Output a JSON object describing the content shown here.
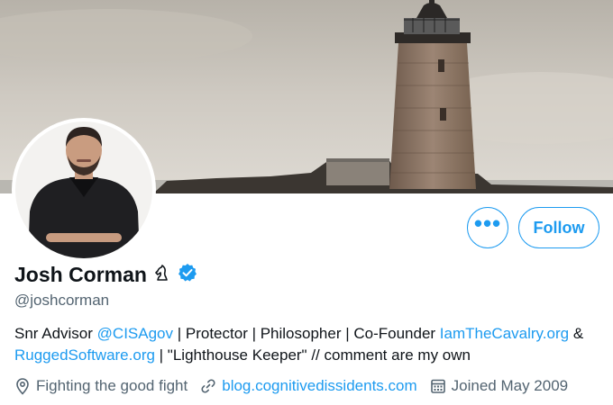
{
  "profile": {
    "name": "Josh Corman",
    "handle": "@joshcorman",
    "bio": {
      "t1": "Snr Advisor ",
      "mention": "@CISAgov",
      "t2": " | Protector | Philosopher | Co-Founder ",
      "link1": "IamTheCavalry.org",
      "t3": " &",
      "link2": "RuggedSoftware.org",
      "t4": " | \"Lighthouse Keeper\" // comment are my own"
    },
    "location": "Fighting the good fight",
    "website": "blog.cognitivedissidents.com",
    "joined": "Joined May 2009"
  },
  "actions": {
    "more_label": "•••",
    "follow_label": "Follow"
  },
  "icons": {
    "name_icon": "knight-chess-icon",
    "verified": "verified-badge-icon",
    "location": "location-pin-icon",
    "website": "link-icon",
    "joined": "calendar-icon"
  },
  "colors": {
    "accent": "#1d9bf0",
    "secondary_text": "#536471",
    "primary_text": "#0f1419"
  }
}
